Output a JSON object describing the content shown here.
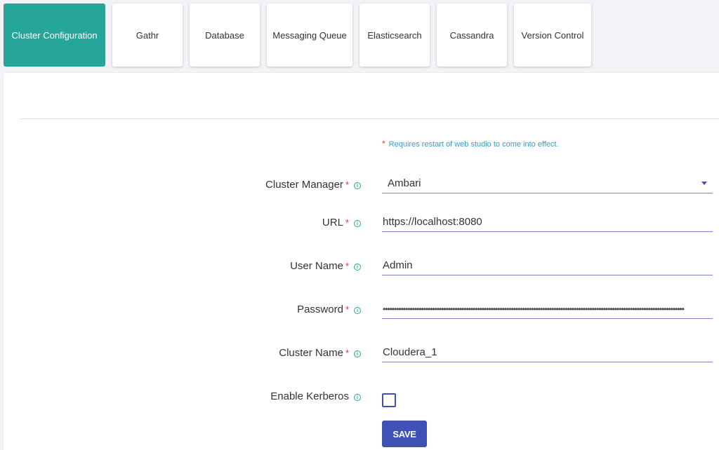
{
  "tabs": [
    {
      "label": "Cluster Configuration",
      "active": true
    },
    {
      "label": "Gathr",
      "active": false
    },
    {
      "label": "Database",
      "active": false
    },
    {
      "label": "Messaging Queue",
      "active": false
    },
    {
      "label": "Elasticsearch",
      "active": false
    },
    {
      "label": "Cassandra",
      "active": false
    },
    {
      "label": "Version Control",
      "active": false
    }
  ],
  "notice": {
    "star": "*",
    "text": "Requires restart of web studio to come into effect."
  },
  "form": {
    "required_marker": "*",
    "info_icon": "i",
    "cluster_manager": {
      "label": "Cluster Manager",
      "value": "Ambari"
    },
    "url": {
      "label": "URL",
      "value": "https://localhost:8080"
    },
    "user_name": {
      "label": "User Name",
      "value": "Admin"
    },
    "password": {
      "label": "Password",
      "value": "••••••••••••••••••••••••••••••••••••••••••••••••••••••••••••••••••••••••••••••••••••••••••••••••••••••••••••••••••••••••••••••••••••••"
    },
    "cluster_name": {
      "label": "Cluster Name",
      "value": "Cloudera_1"
    },
    "enable_kerberos": {
      "label": "Enable Kerberos",
      "checked": false
    },
    "save_label": "SAVE"
  },
  "colors": {
    "accent_teal": "#26a69a",
    "primary_indigo": "#3f51b5",
    "required_red": "#e53935",
    "note_blue": "#3a9bc3"
  }
}
